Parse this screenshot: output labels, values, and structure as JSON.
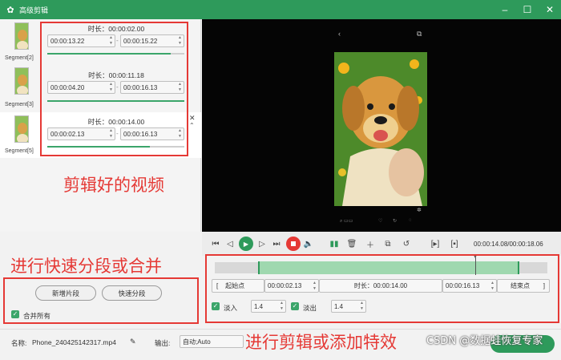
{
  "app": {
    "title": "高级剪辑"
  },
  "segments": [
    {
      "name": "Segment[2]",
      "duration_label": "时长：00:00:02.00",
      "start": "00:00:13.22",
      "end": "00:00:15.22",
      "progress": 0.9
    },
    {
      "name": "Segment[3]",
      "duration_label": "时长：00:00:11.18",
      "start": "00:00:04.20",
      "end": "00:00:16.13",
      "progress": 1.0
    },
    {
      "name": "Segment[5]",
      "duration_label": "时长：00:00:14.00",
      "start": "00:00:02.13",
      "end": "00:00:16.13",
      "progress": 0.75
    }
  ],
  "left_actions": {
    "new_segment": "新增片段",
    "quick_split": "快速分段",
    "merge_all": "合并所有"
  },
  "annotations": {
    "clips": "剪辑好的视频",
    "split": "进行快速分段或合并",
    "edit": "进行剪辑或添加特效"
  },
  "watermark": "CSDN @数据蛙恢复专家",
  "player": {
    "timecode": "00:00:14.08/00:00:18.06"
  },
  "edit": {
    "start_label": "起始点",
    "start_value": "00:00:02.13",
    "duration_label": "时长：00:00:14.00",
    "end_value": "00:00:16.13",
    "end_label": "结束点",
    "fade_in_label": "淡入",
    "fade_in_value": "1.4",
    "fade_out_label": "淡出",
    "fade_out_value": "1.4"
  },
  "footer": {
    "name_label": "名称:",
    "file_name": "Phone_240425142317.mp4",
    "output_label": "输出:",
    "output_value": "自动;Auto"
  },
  "colors": {
    "brand": "#2e9a5b",
    "annotation": "#e53935"
  }
}
